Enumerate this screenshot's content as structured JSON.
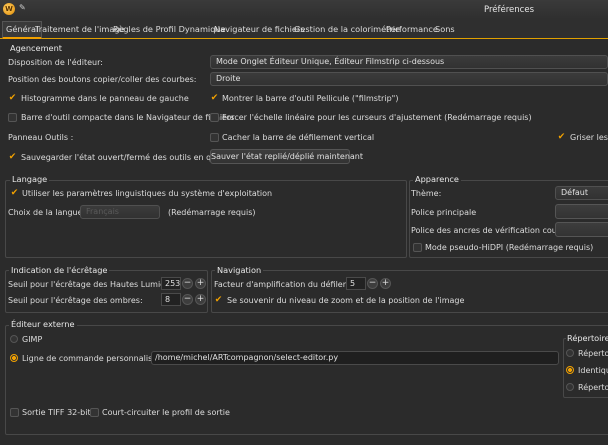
{
  "window": {
    "title": "Préférences",
    "logo_letter": "W"
  },
  "tabs": [
    "Général",
    "Traitement de l'image",
    "Règles de Profil Dynamique",
    "Navigateur de fichiers",
    "Gestion de la colorimétrie",
    "Performance",
    "Sons"
  ],
  "agencement": {
    "title": "Agencement",
    "editor_layout_label": "Disposition de l'éditeur:",
    "editor_layout_value": "Mode Onglet Éditeur Unique, Éditeur Filmstrip ci-dessous",
    "curve_buttons_label": "Position des boutons copier/coller des courbes:",
    "curve_buttons_value": "Droite",
    "histogram_left": "Histogramme dans le panneau de gauche",
    "show_filmstrip": "Montrer la barre d'outil Pellicule (\"filmstrip\")",
    "compact_toolbar": "Barre d'outil compacte dans le Navigateur de fichiers",
    "linear_scale": "Forcer l'échelle linéaire pour les curseurs d'ajustement (Redémarrage requis)",
    "panneau_outils": "Panneau Outils :",
    "hide_scrollbar": "Cacher la barre de défilement vertical",
    "griser": "Griser les o",
    "save_state": "Sauvegarder l'état ouvert/fermé des outils en quittant",
    "save_now_button": "Sauver l'état replié/déplié maintenant"
  },
  "langage": {
    "title": "Langage",
    "use_system": "Utiliser les paramètres linguistiques du système d'exploitation",
    "choose_label": "Choix de la langue:",
    "language_value": "Français",
    "restart": "(Redémarrage requis)"
  },
  "apparence": {
    "title": "Apparence",
    "theme_label": "Thème:",
    "theme_value": "Défaut",
    "font_label": "Police principale",
    "anchor_font_label": "Police des ancres de vérification couleur:",
    "hidpi": "Mode pseudo-HiDPI (Redémarrage requis)"
  },
  "clipping": {
    "title": "Indication de l'écrêtage",
    "highlights_label": "Seuil pour l'écrêtage des Hautes Lumières:",
    "highlights_value": "253",
    "shadows_label": "Seuil pour l'écrêtage des ombres:",
    "shadows_value": "8"
  },
  "navigation": {
    "title": "Navigation",
    "scroll_label": "Facteur d'amplification du défilement:",
    "scroll_value": "5",
    "remember_zoom": "Se souvenir du niveau de zoom et de la position de l'image"
  },
  "external_editor": {
    "title": "Éditeur externe",
    "gimp": "GIMP",
    "custom_cmd": "Ligne de commande personnalisée:",
    "cmd_value": "/home/michel/ARTcompagnon/select-editor.py",
    "tiff": "Sortie TIFF 32-bit",
    "bypass": "Court-circuiter le profil de sortie",
    "output_dir_title": "Répertoire d",
    "dir_opt1": "Répertoi",
    "dir_opt2": "Identique",
    "dir_opt3": "Répertoi"
  },
  "glyphs": {
    "check": "✔",
    "minus": "−",
    "plus": "+",
    "pin": "📌",
    "chevron": "▾"
  }
}
